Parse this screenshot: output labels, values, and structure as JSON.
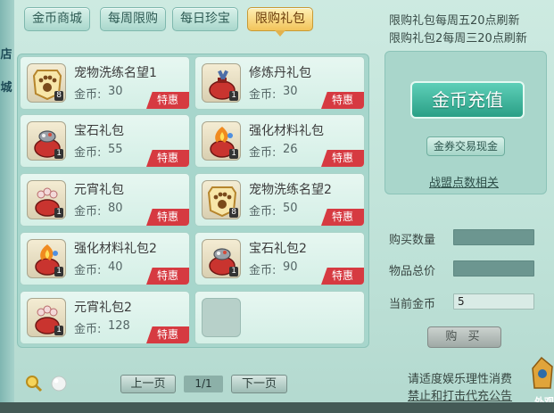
{
  "tabs": [
    {
      "label": "金币商城",
      "active": false
    },
    {
      "label": "每周限购",
      "active": false
    },
    {
      "label": "每日珍宝",
      "active": false
    },
    {
      "label": "限购礼包",
      "active": true
    }
  ],
  "notices": [
    "限购礼包每周五20点刷新",
    "限购礼包2每周三20点刷新"
  ],
  "left_edge_chars": [
    "店",
    "城"
  ],
  "price_label": "金币:",
  "badge_label": "特惠",
  "items": [
    {
      "name": "宠物洗练名望1",
      "price": "30",
      "count": "8",
      "icon": "paw-badge-icon"
    },
    {
      "name": "修炼丹礼包",
      "price": "30",
      "count": "1",
      "icon": "gift-bag-icon"
    },
    {
      "name": "宝石礼包",
      "price": "55",
      "count": "1",
      "icon": "gem-bag-icon"
    },
    {
      "name": "强化材料礼包",
      "price": "26",
      "count": "1",
      "icon": "fire-bag-icon"
    },
    {
      "name": "元宵礼包",
      "price": "80",
      "count": "1",
      "icon": "lantern-bag-icon"
    },
    {
      "name": "宠物洗练名望2",
      "price": "50",
      "count": "8",
      "icon": "paw-badge-icon"
    },
    {
      "name": "强化材料礼包2",
      "price": "40",
      "count": "1",
      "icon": "fire-bag-icon"
    },
    {
      "name": "宝石礼包2",
      "price": "90",
      "count": "1",
      "icon": "gem-bag-icon"
    },
    {
      "name": "元宵礼包2",
      "price": "128",
      "count": "1",
      "icon": "lantern-bag-icon"
    }
  ],
  "recharge": {
    "button": "金币充值",
    "coupon_button": "金券交易现金",
    "alliance_link": "战盟点数相关"
  },
  "form": {
    "quantity_label": "购买数量",
    "quantity_value": "",
    "total_label": "物品总价",
    "total_value": "",
    "gold_label": "当前金币",
    "gold_value": "5",
    "buy_button": "购 买"
  },
  "pagination": {
    "prev": "上一页",
    "page": "1/1",
    "next": "下一页"
  },
  "footer": {
    "line1": "请适度娱乐理性消费",
    "line2": "禁止和打击代充公告"
  },
  "corner_text": "外观",
  "colors": {
    "accent": "#2a9f86",
    "badge": "#d63a41",
    "tab_active": "#f2c45a"
  }
}
